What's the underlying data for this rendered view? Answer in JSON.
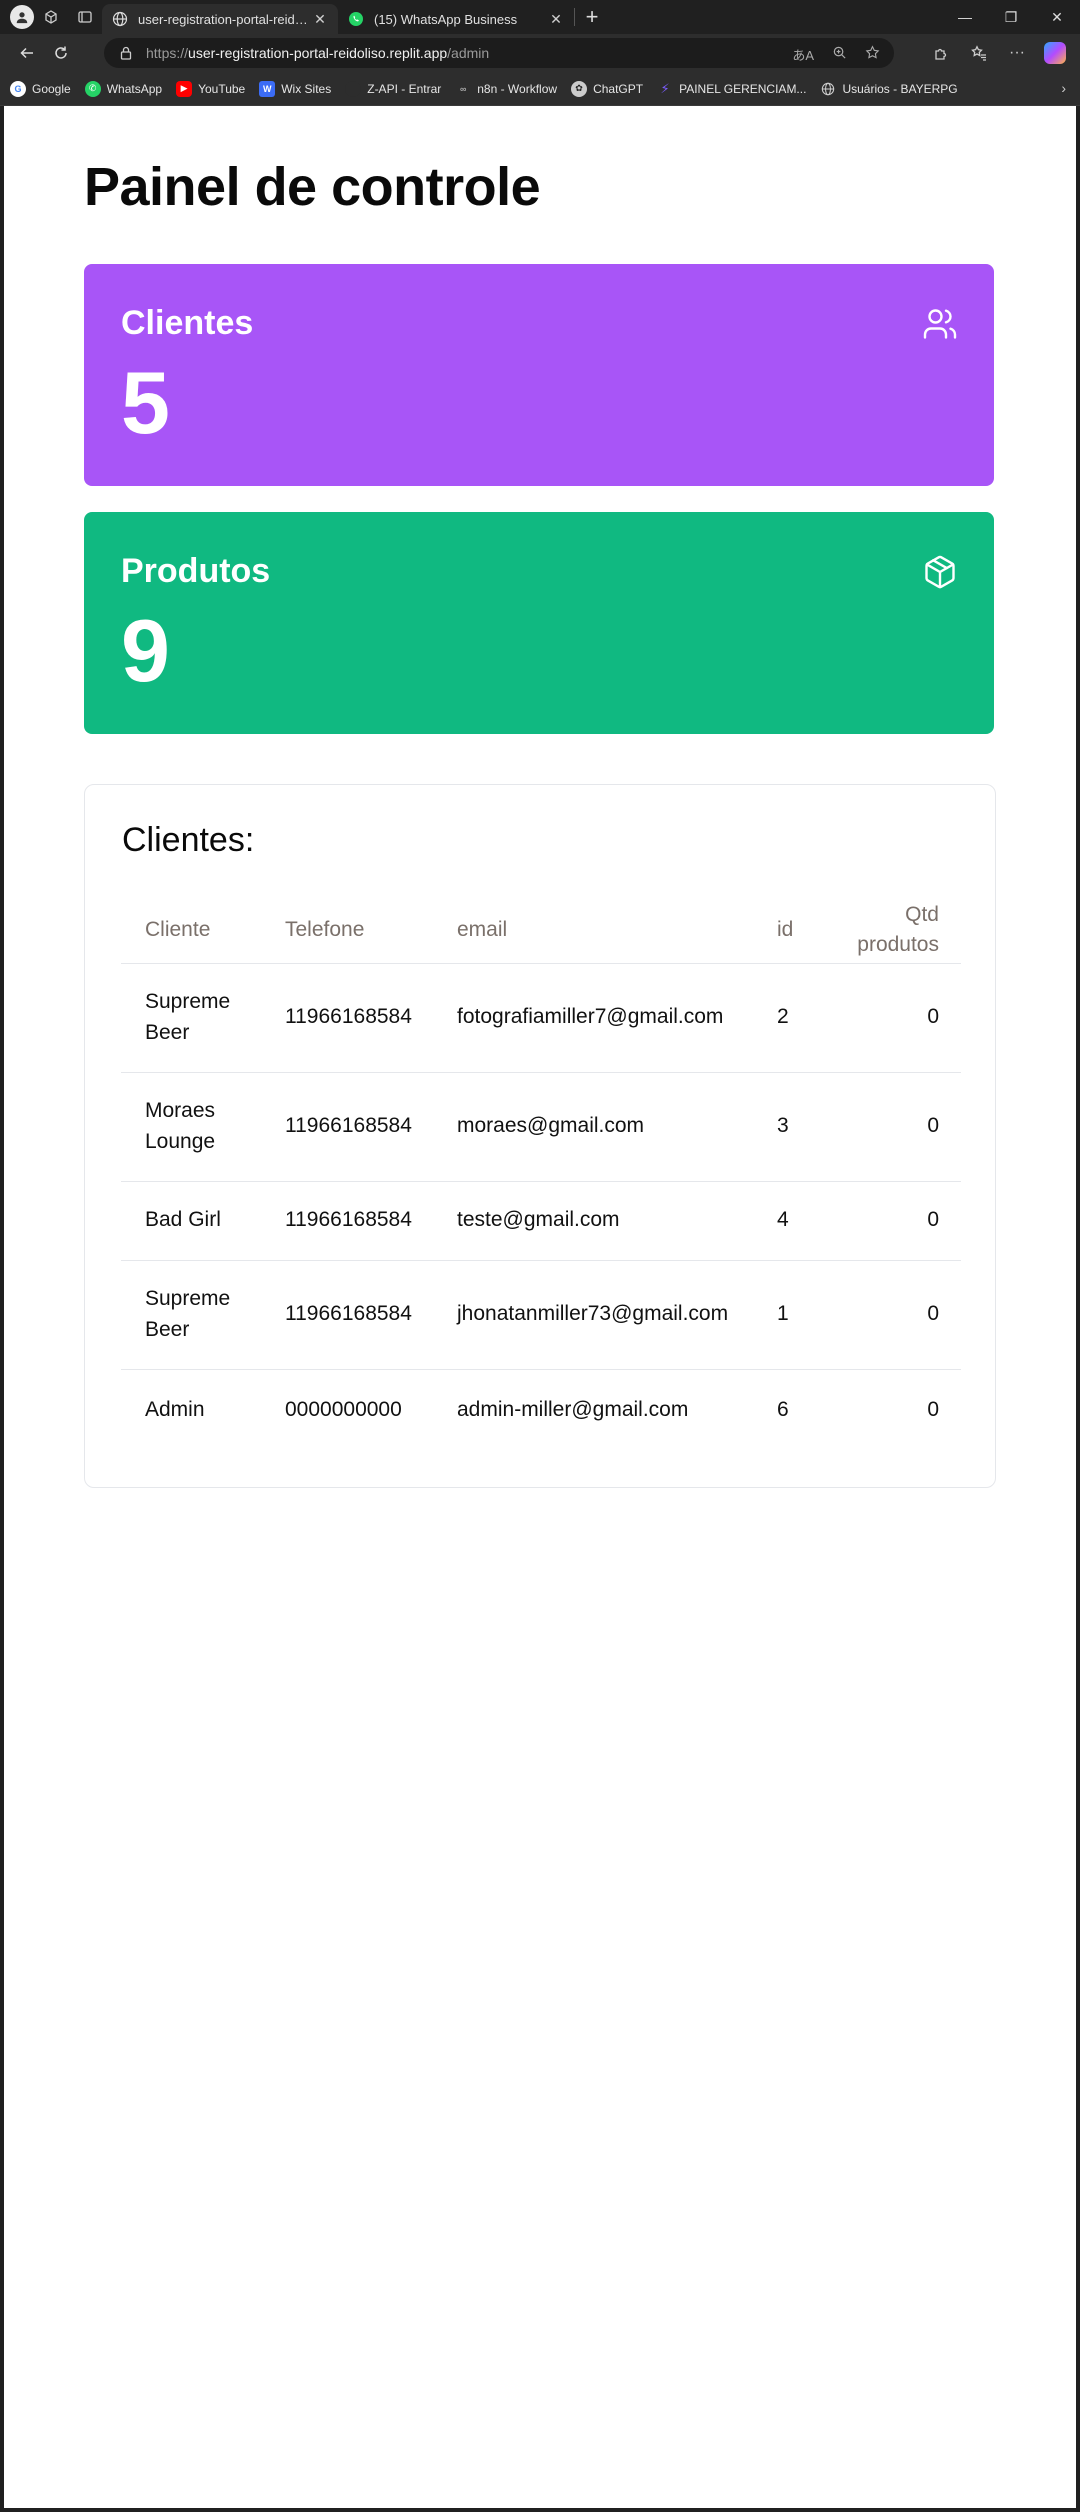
{
  "browser": {
    "tabs": [
      {
        "title": "user-registration-portal-reidoliso.replit.app",
        "active": true
      },
      {
        "title": "(15) WhatsApp Business",
        "active": false
      }
    ],
    "url": {
      "scheme": "https://",
      "host": "user-registration-portal-reidoliso.replit.app",
      "path": "/admin"
    },
    "bookmarks": [
      {
        "label": "Google",
        "icon": "google-icon",
        "color": "#ffffff"
      },
      {
        "label": "WhatsApp",
        "icon": "whatsapp-icon",
        "color": "#25d366"
      },
      {
        "label": "YouTube",
        "icon": "youtube-icon",
        "color": "#ff0000"
      },
      {
        "label": "Wix Sites",
        "icon": "wix-icon",
        "color": "#3b6cf6"
      },
      {
        "label": "Z-API - Entrar",
        "icon": "zapi-icon",
        "color": "#2d2d2d"
      },
      {
        "label": "n8n - Workflow",
        "icon": "n8n-icon",
        "color": "#888888"
      },
      {
        "label": "ChatGPT",
        "icon": "chatgpt-icon",
        "color": "#cccccc"
      },
      {
        "label": "PAINEL GERENCIAM...",
        "icon": "painel-icon",
        "color": "#7b5cff"
      },
      {
        "label": "Usuários - BAYERPG",
        "icon": "globe-icon",
        "color": "#cccccc"
      }
    ]
  },
  "page": {
    "title": "Painel de controle",
    "stats": {
      "clients": {
        "label": "Clientes",
        "value": "5",
        "color": "#a855f7",
        "icon": "users-icon"
      },
      "products": {
        "label": "Produtos",
        "value": "9",
        "color": "#10b981",
        "icon": "package-icon"
      }
    },
    "clients_table": {
      "title": "Clientes:",
      "headers": {
        "cliente": "Cliente",
        "telefone": "Telefone",
        "email": "email",
        "id": "id",
        "qtd": "Qtd produtos"
      },
      "rows": [
        {
          "cliente": "Supreme Beer",
          "telefone": "11966168584",
          "email": "fotografiamiller7@gmail.com",
          "id": "2",
          "qtd": "0"
        },
        {
          "cliente": "Moraes Lounge",
          "telefone": "11966168584",
          "email": "moraes@gmail.com",
          "id": "3",
          "qtd": "0"
        },
        {
          "cliente": "Bad Girl",
          "telefone": "11966168584",
          "email": "teste@gmail.com",
          "id": "4",
          "qtd": "0"
        },
        {
          "cliente": "Supreme Beer",
          "telefone": "11966168584",
          "email": "jhonatanmiller73@gmail.com",
          "id": "1",
          "qtd": "0"
        },
        {
          "cliente": "Admin",
          "telefone": "0000000000",
          "email": "admin-miller@gmail.com",
          "id": "6",
          "qtd": "0"
        }
      ]
    }
  }
}
